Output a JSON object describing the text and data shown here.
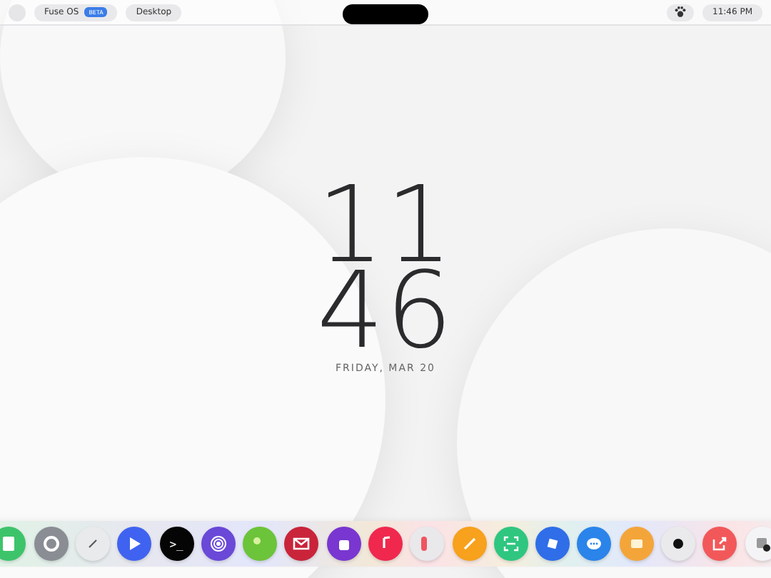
{
  "top_bar": {
    "app_name": "Fuse OS",
    "badge": "BETA",
    "workspace": "Desktop",
    "time": "11:46 PM"
  },
  "clock": {
    "hours": "11",
    "minutes": "46",
    "date": "FRIDAY, MAR 20"
  },
  "dock": [
    {
      "kind": "calculator",
      "color": "#3dc46a"
    },
    {
      "kind": "settings",
      "color": "#8a8d93"
    },
    {
      "kind": "compass",
      "color": "#e9eaec"
    },
    {
      "kind": "play",
      "color": "#3f63f0"
    },
    {
      "kind": "terminal",
      "color": "#050505",
      "glyph": ">_"
    },
    {
      "kind": "radio",
      "color": "#6a48d8"
    },
    {
      "kind": "maps",
      "color": "#6cc43a"
    },
    {
      "kind": "mail",
      "color": "#c9243a"
    },
    {
      "kind": "bag",
      "color": "#7a36d0"
    },
    {
      "kind": "music",
      "color": "#f0284e"
    },
    {
      "kind": "toggles",
      "color": "#e9e9ec"
    },
    {
      "kind": "pencil",
      "color": "#f7a11c"
    },
    {
      "kind": "scanner",
      "color": "#2fc680"
    },
    {
      "kind": "cube",
      "color": "#2f6ee8"
    },
    {
      "kind": "chat",
      "color": "#2a84ea"
    },
    {
      "kind": "slides",
      "color": "#f4a53a"
    },
    {
      "kind": "camera",
      "color": "#eaeaec"
    },
    {
      "kind": "share",
      "color": "#f2585a"
    },
    {
      "kind": "preview",
      "color": "#f4f4f6"
    }
  ]
}
